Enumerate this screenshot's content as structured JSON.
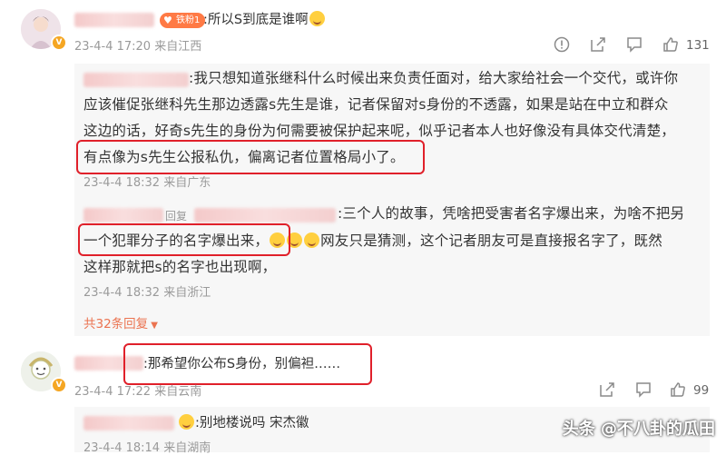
{
  "comment1": {
    "text": ":所以S到底是谁啊",
    "badge": "铁粉1",
    "meta": "23-4-4 17:20 来自江西",
    "likes": "131"
  },
  "reply1": {
    "lines": [
      ":我只想知道张继科什么时候出来负责任面对，给大家给社会一个交代，或许你",
      "应该催促张继科先生那边透露s先生是谁，记者保留对s身份的不透露，如果是站在中立和群众",
      "这边的话，好奇s先生的身份为何需要被保护起来呢，似乎记者本人也好像没有具体交代清楚，",
      "有点像为s先生公报私仇，偏离记者位置格局小了。"
    ],
    "meta": "23-4-4 18:32 来自广东"
  },
  "reply2": {
    "tag": "回复",
    "lines": [
      ":三个人的故事，凭啥把受害者名字爆出来，为啥不把另",
      "一个犯罪分子的名字爆出来，",
      "网友只是猜测，这个记者朋友可是直接报名字了，既然",
      "这样那就把s的名字也出现啊，"
    ],
    "meta": "23-4-4 18:32 来自浙江"
  },
  "more_replies": "共32条回复",
  "comment2": {
    "text": ":那希望你公布S身份，别偏袒……",
    "meta": "23-4-4 17:22 来自云南",
    "likes": "99"
  },
  "reply3": {
    "text": ":别地楼说吗 宋杰徽",
    "meta": "23-4-4 18:14 来自湖南"
  },
  "watermark": "头条 @不八卦的瓜田",
  "icons": [
    "report-icon",
    "share-icon",
    "comment-icon",
    "like-icon"
  ]
}
